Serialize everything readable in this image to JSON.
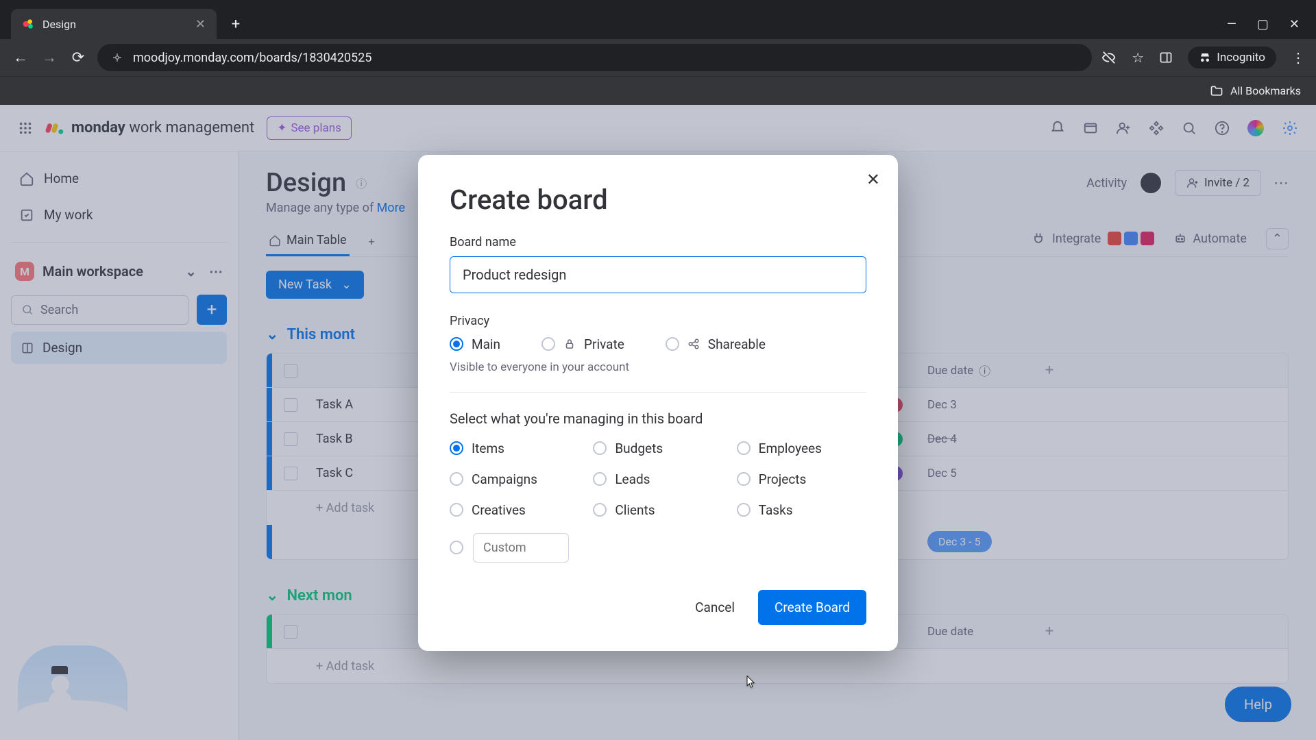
{
  "browser": {
    "tab_title": "Design",
    "url": "moodjoy.monday.com/boards/1830420525",
    "incognito_label": "Incognito",
    "all_bookmarks": "All Bookmarks"
  },
  "header": {
    "brand_bold": "monday",
    "brand_rest": " work management",
    "see_plans": "See plans"
  },
  "sidebar": {
    "home": "Home",
    "mywork": "My work",
    "workspace": "Main workspace",
    "workspace_initial": "M",
    "search_placeholder": "Search",
    "board": "Design"
  },
  "main": {
    "title": "Design",
    "subtitle_prefix": "Manage any type of",
    "see_more": "More",
    "activity": "Activity",
    "invite": "Invite / 2",
    "tab_main": "Main Table",
    "integrate": "Integrate",
    "automate": "Automate",
    "new_task": "New Task",
    "group1": "This mont",
    "group2": "Next mon",
    "col_due": "Due date",
    "tasks": [
      "Task A",
      "Task B",
      "Task C"
    ],
    "dates": [
      "Dec 3",
      "Dec 4",
      "Dec 5"
    ],
    "add_task": "+ Add task",
    "timeline_pill": "Dec 3 - 5",
    "help": "Help"
  },
  "modal": {
    "title": "Create board",
    "board_name_label": "Board name",
    "board_name_value": "Product redesign",
    "privacy_label": "Privacy",
    "privacy_options": {
      "main": "Main",
      "private": "Private",
      "shareable": "Shareable"
    },
    "privacy_hint": "Visible to everyone in your account",
    "managing_label": "Select what you're managing in this board",
    "managing_options": [
      "Items",
      "Budgets",
      "Employees",
      "Campaigns",
      "Leads",
      "Projects",
      "Creatives",
      "Clients",
      "Tasks"
    ],
    "custom_placeholder": "Custom",
    "cancel": "Cancel",
    "create": "Create Board"
  }
}
